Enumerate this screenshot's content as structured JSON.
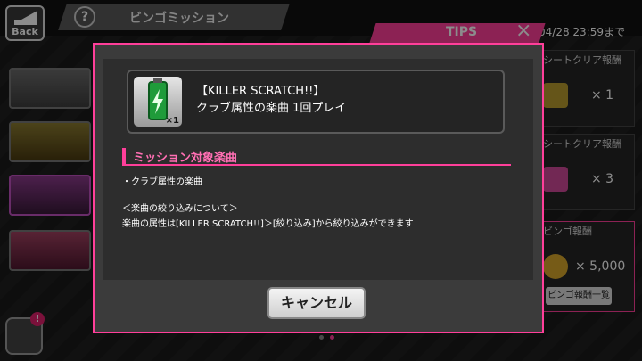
{
  "header": {
    "back_label": "Back",
    "help_icon_label": "?",
    "title": "ビンゴミッション",
    "date": "04/28 23:59まで"
  },
  "tips": {
    "tab_label": "TIPS",
    "close_symbol": "×"
  },
  "right_panels": [
    {
      "heading": "シートクリア報酬",
      "multiplier": "× 1"
    },
    {
      "heading": "シートクリア報酬",
      "multiplier": "× 3"
    },
    {
      "heading": "ビンゴ報酬",
      "multiplier": "× 5,000"
    }
  ],
  "reward_list_button": "ビンゴ報酬一覧",
  "badge": "!",
  "dialog": {
    "item": {
      "quantity": "×1",
      "title": "【KILLER SCRATCH!!】",
      "description": "クラブ属性の楽曲 1回プレイ"
    },
    "section_title": "ミッション対象楽曲",
    "bullet": "・クラブ属性の楽曲",
    "note_heading": "＜楽曲の絞り込みについて＞",
    "note_body": "楽曲の属性は[KILLER SCRATCH!!]＞[絞り込み]から絞り込みができます",
    "cancel_label": "キャンセル"
  },
  "colors": {
    "accent": "#ff3f9a"
  }
}
